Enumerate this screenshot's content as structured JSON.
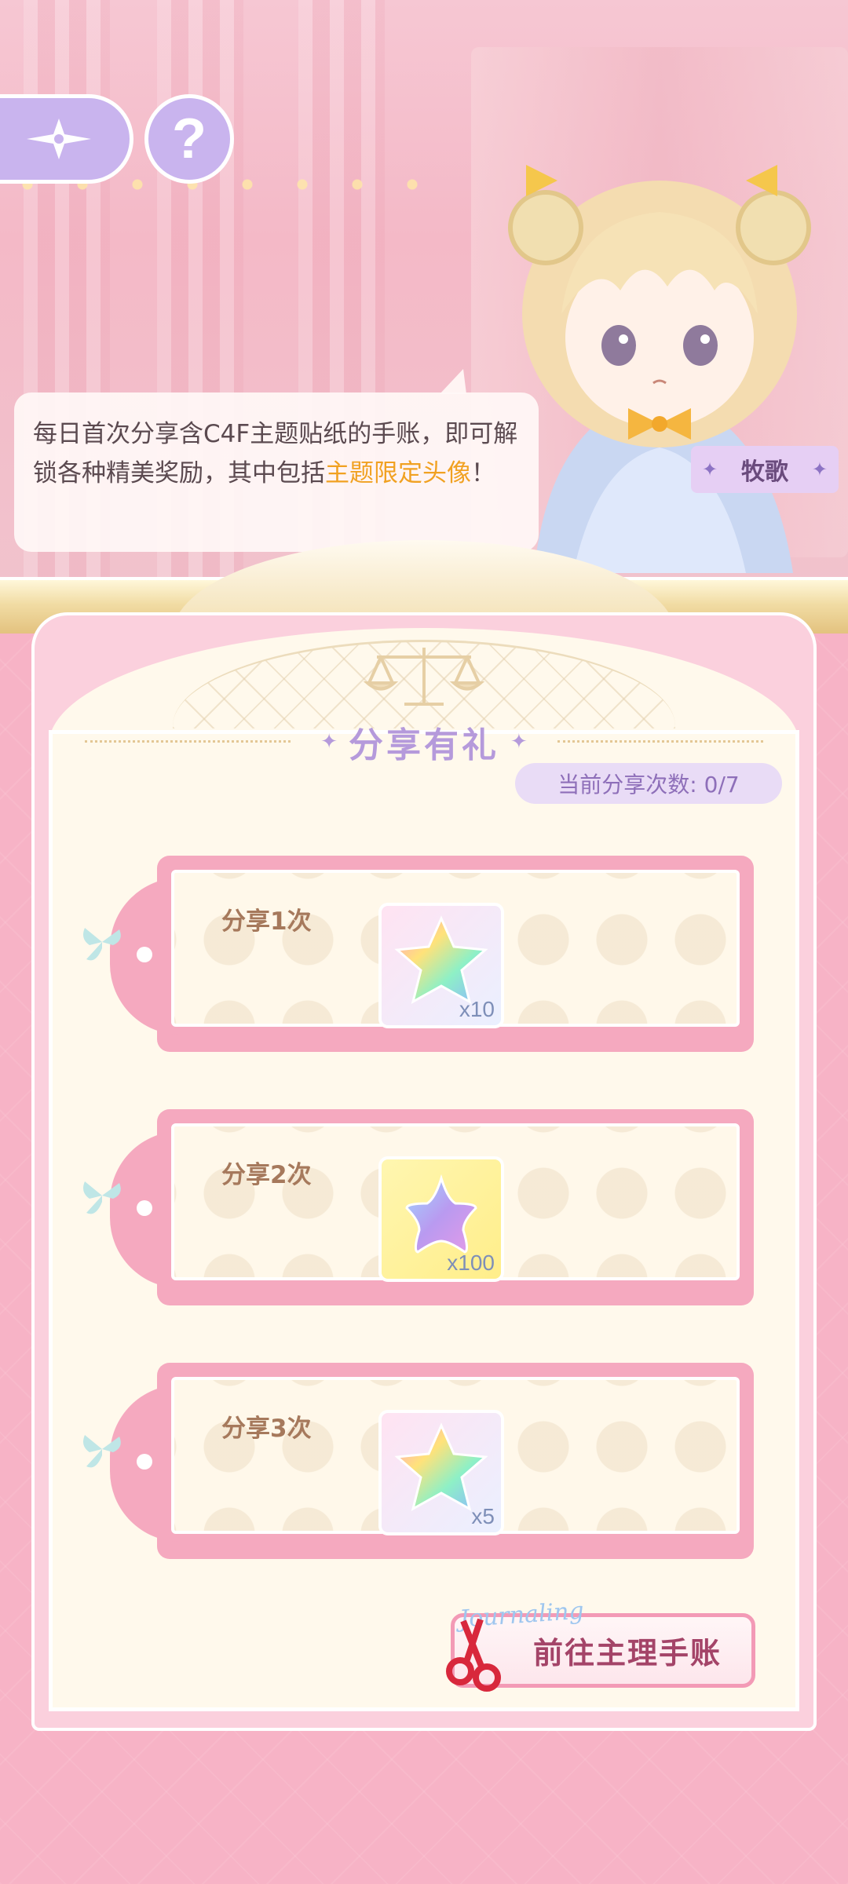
{
  "top_buttons": {
    "spark_icon": "four-point-sparkle-icon",
    "help_glyph": "?"
  },
  "npc": {
    "dialogue_part1": "每日首次分享含C4F主题贴纸的手账，即可解锁各种精美奖励，其中包括",
    "dialogue_highlight": "主题限定头像",
    "dialogue_end": "！",
    "name": "牧歌"
  },
  "panel": {
    "title": "分享有礼",
    "share_count_label": "当前分享次数: 0/7"
  },
  "rewards": [
    {
      "label": "分享1次",
      "item": "rainbow-crystal-star",
      "quantity": "x10"
    },
    {
      "label": "分享2次",
      "item": "purple-jelly-star",
      "quantity": "x100"
    },
    {
      "label": "分享3次",
      "item": "rainbow-crystal-star",
      "quantity": "x5"
    }
  ],
  "go_button": {
    "label": "前往主理手账",
    "deco_text": "Journaling"
  },
  "colors": {
    "accent_purple": "#b59adb",
    "highlight_orange": "#f1a121",
    "card_pink": "#f5a9bf",
    "button_text": "#a44468"
  }
}
